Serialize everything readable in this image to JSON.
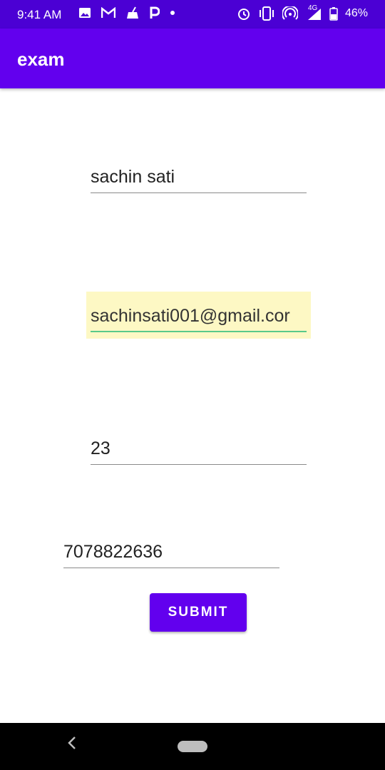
{
  "status_bar": {
    "time": "9:41 AM",
    "network": "4G",
    "battery_percent": "46%",
    "icons_left": [
      "image-icon",
      "gmail-icon",
      "broom-icon",
      "paytm-icon",
      "dot-icon"
    ],
    "icons_right": [
      "alarm-icon",
      "vibrate-icon",
      "hotspot-icon",
      "signal-icon",
      "battery-icon"
    ]
  },
  "app_bar": {
    "title": "exam",
    "color": "#6200ee"
  },
  "form": {
    "name_value": "sachin sati",
    "email_value": "sachinsati001@gmail.cor",
    "age_value": "23",
    "phone_value": "7078822636",
    "submit_label": "SUBMIT"
  },
  "nav_bar": {
    "icons": [
      "back-icon",
      "home-pill-icon"
    ]
  },
  "colors": {
    "accent": "#6200ee",
    "status_bar": "#4b00d4",
    "focus_underline": "#58c98a",
    "autofill_highlight": "#fdf8c4"
  }
}
